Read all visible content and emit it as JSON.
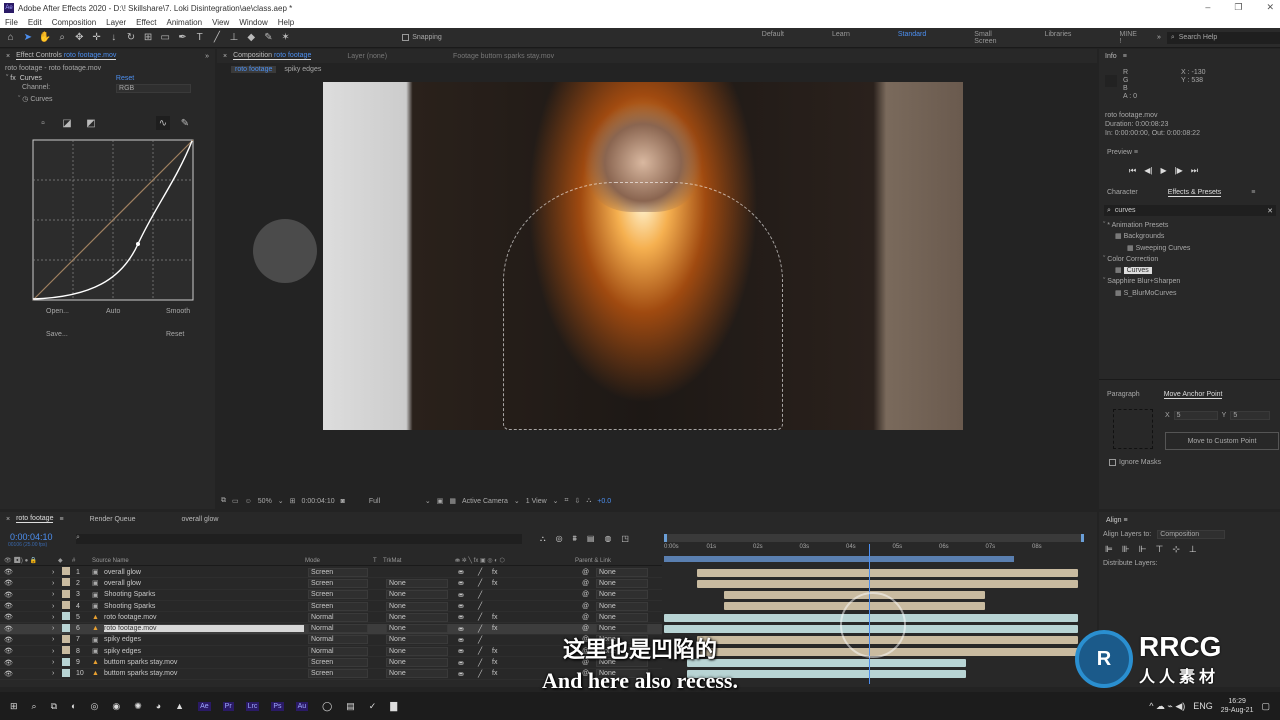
{
  "app": {
    "title": "Adobe After Effects 2020 - D:\\! Skillshare\\7. Loki Disintegration\\ae\\class.aep *",
    "logo": "Ae"
  },
  "window_controls": [
    "–",
    "❐",
    "✕"
  ],
  "menu": [
    "File",
    "Edit",
    "Composition",
    "Layer",
    "Effect",
    "Animation",
    "View",
    "Window",
    "Help"
  ],
  "toolbar": {
    "snapping": "Snapping",
    "workspaces": [
      "Default",
      "Learn",
      "Standard",
      "Small Screen",
      "Libraries",
      "MINE !"
    ],
    "active_workspace": "Standard",
    "search_placeholder": "Search Help"
  },
  "effect_controls": {
    "tab": "Effect Controls",
    "tab_target": "roto footage.mov",
    "breadcrumb": "roto footage - roto footage.mov",
    "effect": "Curves",
    "reset": "Reset",
    "channel_label": "Channel:",
    "channel_value": "RGB",
    "curves_label": "Curves",
    "buttons": [
      "Open...",
      "Auto",
      "Smooth",
      "Save...",
      "Reset"
    ]
  },
  "composition": {
    "tab": "Composition",
    "tab_target": "roto footage",
    "layer_tab": "Layer (none)",
    "footage_tab": "Footage buttom sparks stay.mov",
    "subtabs": [
      "roto footage",
      "spiky edges"
    ],
    "viewer_bar": {
      "zoom": "50%",
      "timecode": "0:00:04:10",
      "resolution": "Full",
      "camera": "Active Camera",
      "views": "1 View",
      "exposure": "+0.0"
    }
  },
  "info": {
    "title": "Info",
    "r": "R",
    "g": "G",
    "b": "B",
    "a": "A : 0",
    "x": "X : -130",
    "y": "Y : 538",
    "file": "roto footage.mov",
    "duration": "Duration: 0:00:08:23",
    "inout": "In: 0:00:00:00, Out: 0:00:08:22"
  },
  "preview": {
    "title": "Preview",
    "controls": [
      "⏮",
      "◀|",
      "▶",
      "|▶",
      "⏭"
    ]
  },
  "effects_presets": {
    "tabs": [
      "Character",
      "Effects & Presets"
    ],
    "search": "curves",
    "tree": [
      {
        "label": "* Animation Presets",
        "level": 0
      },
      {
        "label": "Backgrounds",
        "level": 1
      },
      {
        "label": "Sweeping Curves",
        "level": 2
      },
      {
        "label": "Color Correction",
        "level": 0
      },
      {
        "label": "Curves",
        "level": 1,
        "selected": true
      },
      {
        "label": "Sapphire Blur+Sharpen",
        "level": 0
      },
      {
        "label": "S_BlurMoCurves",
        "level": 1
      }
    ]
  },
  "anchor": {
    "tabs": [
      "Paragraph",
      "Move Anchor Point"
    ],
    "x_label": "X",
    "x": "5",
    "y_label": "Y",
    "y": "5",
    "button": "Move to Custom Point",
    "ignore_masks": "Ignore Masks"
  },
  "align": {
    "title": "Align",
    "align_to_label": "Align Layers to:",
    "align_to": "Composition",
    "distribute": "Distribute Layers:"
  },
  "timeline": {
    "tabs": [
      "roto footage",
      "Render Queue",
      "overall glow"
    ],
    "timecode": "0:00:04:10",
    "frames": "00106 (25.00 fps)",
    "columns": {
      "num": "#",
      "source": "Source Name",
      "mode": "Mode",
      "t": "T",
      "trkmat": "TrkMat",
      "parent": "Parent & Link"
    },
    "ruler": [
      "0:00s",
      "01s",
      "02s",
      "03s",
      "04s",
      "05s",
      "06s",
      "07s",
      "08s"
    ],
    "playhead_seconds": 4.4,
    "duration_seconds": 9,
    "layers": [
      {
        "n": "1",
        "name": "overall glow",
        "type": "comp",
        "mode": "Screen",
        "trkmat": "",
        "parent": "None",
        "fx": true,
        "in": 0.7,
        "out": 8.9,
        "color": "#c9bba0"
      },
      {
        "n": "2",
        "name": "overall glow",
        "type": "comp",
        "mode": "Screen",
        "trkmat": "None",
        "parent": "None",
        "fx": true,
        "in": 0.7,
        "out": 8.9,
        "color": "#c9bba0"
      },
      {
        "n": "3",
        "name": "Shooting Sparks",
        "type": "comp",
        "mode": "Screen",
        "trkmat": "None",
        "parent": "None",
        "fx": false,
        "in": 1.3,
        "out": 6.9,
        "color": "#c9bba0"
      },
      {
        "n": "4",
        "name": "Shooting Sparks",
        "type": "comp",
        "mode": "Screen",
        "trkmat": "None",
        "parent": "None",
        "fx": false,
        "in": 1.3,
        "out": 6.9,
        "color": "#c9bba0"
      },
      {
        "n": "5",
        "name": "roto footage.mov",
        "type": "footage",
        "mode": "Normal",
        "trkmat": "None",
        "parent": "None",
        "fx": true,
        "in": 0,
        "out": 8.9,
        "color": "#b8d4d4"
      },
      {
        "n": "6",
        "name": "roto footage.mov",
        "type": "footage",
        "mode": "Normal",
        "trkmat": "None",
        "parent": "None",
        "fx": true,
        "in": 0,
        "out": 8.9,
        "color": "#b8d4d4",
        "selected": true
      },
      {
        "n": "7",
        "name": "spiky edges",
        "type": "comp",
        "mode": "Normal",
        "trkmat": "None",
        "parent": "None",
        "fx": false,
        "in": 0.7,
        "out": 8.9,
        "color": "#c9bba0"
      },
      {
        "n": "8",
        "name": "spiky edges",
        "type": "comp",
        "mode": "Normal",
        "trkmat": "None",
        "parent": "None",
        "fx": true,
        "in": 0.7,
        "out": 8.9,
        "color": "#c9bba0"
      },
      {
        "n": "9",
        "name": "buttom sparks stay.mov",
        "type": "footage",
        "mode": "Screen",
        "trkmat": "None",
        "parent": "None",
        "fx": true,
        "in": 0.5,
        "out": 6.5,
        "color": "#b8d4d4"
      },
      {
        "n": "10",
        "name": "buttom sparks stay.mov",
        "type": "footage",
        "mode": "Screen",
        "trkmat": "None",
        "parent": "None",
        "fx": true,
        "in": 0.5,
        "out": 6.5,
        "color": "#b8d4d4"
      }
    ]
  },
  "subtitle": {
    "zh": "这里也是凹陷的",
    "en": "And here also recess."
  },
  "watermark": {
    "text": "RRCG",
    "sub": "人人素材"
  },
  "taskbar": {
    "apps": [
      "Ae",
      "Pr",
      "Lrc",
      "Ps",
      "Au"
    ],
    "lang": "ENG",
    "time": "16:29",
    "date": "29-Aug-21"
  },
  "colors": {
    "accent": "#4c8ff0",
    "panel": "#282828"
  }
}
